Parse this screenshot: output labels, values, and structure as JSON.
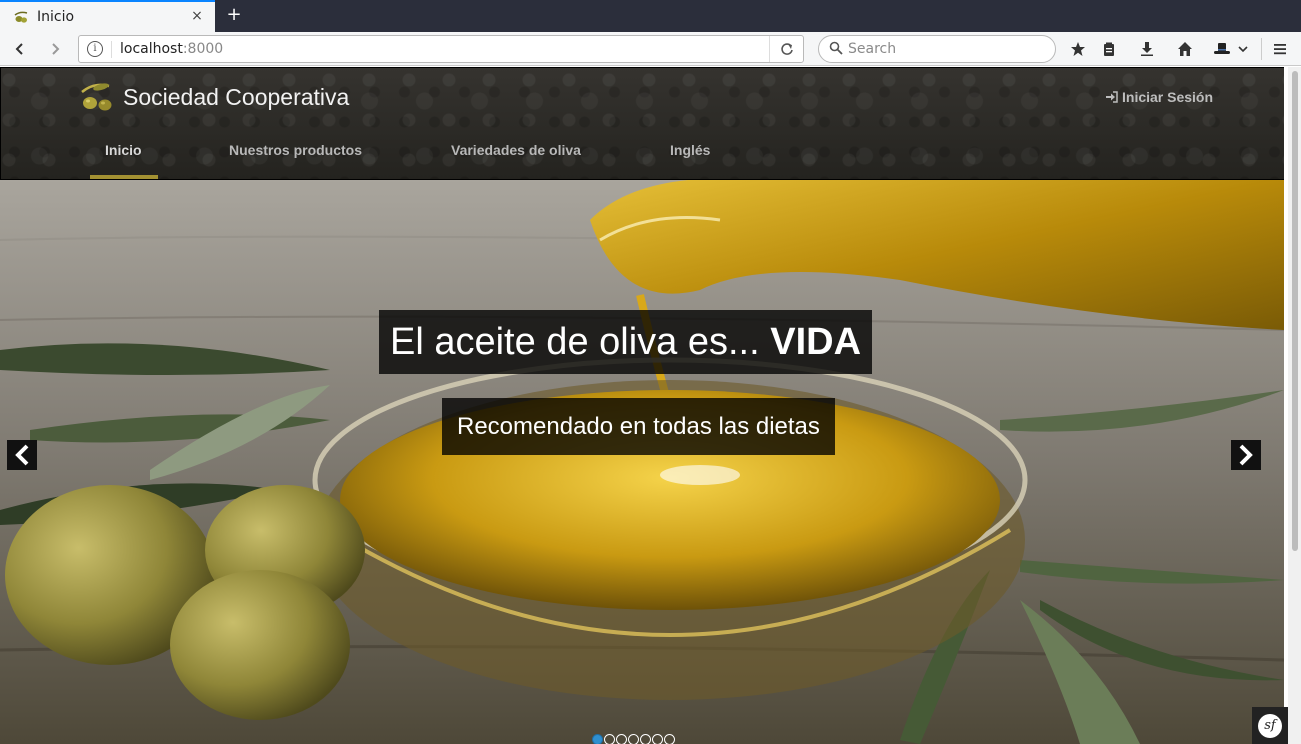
{
  "browser": {
    "tab": {
      "title": "Inicio",
      "close": "×"
    },
    "new_tab": "+",
    "url": {
      "host": "localhost",
      "port": ":8000"
    },
    "search_placeholder": "Search"
  },
  "site": {
    "brand": "Sociedad Cooperativa",
    "login": "Iniciar Sesión",
    "menu": [
      {
        "label": "Inicio",
        "active": true
      },
      {
        "label": "Nuestros productos"
      },
      {
        "label": "Variedades de oliva"
      },
      {
        "label": "Inglés"
      }
    ]
  },
  "hero": {
    "title_prefix": "El aceite de oliva es... ",
    "title_emphasis": "VIDA",
    "subtitle": "Recomendado en todas las dietas",
    "slides_count": 7,
    "active_slide": 1
  },
  "icons": {
    "back": "back-arrow-icon",
    "forward": "forward-arrow-icon",
    "reload": "reload-icon",
    "info": "info-icon",
    "search": "magnifier-icon",
    "bookmark": "star-icon",
    "reader": "clipboard-icon",
    "download": "download-icon",
    "home": "home-icon",
    "profile": "hat-icon",
    "menu": "hamburger-icon",
    "login": "sign-in-icon",
    "prev_slide": "chevron-left-icon",
    "next_slide": "chevron-right-icon",
    "debug": "symfony-icon"
  },
  "colors": {
    "accent": "#a39132",
    "tab_indicator": "#0a84ff",
    "active_dot": "#2f8fcf"
  }
}
